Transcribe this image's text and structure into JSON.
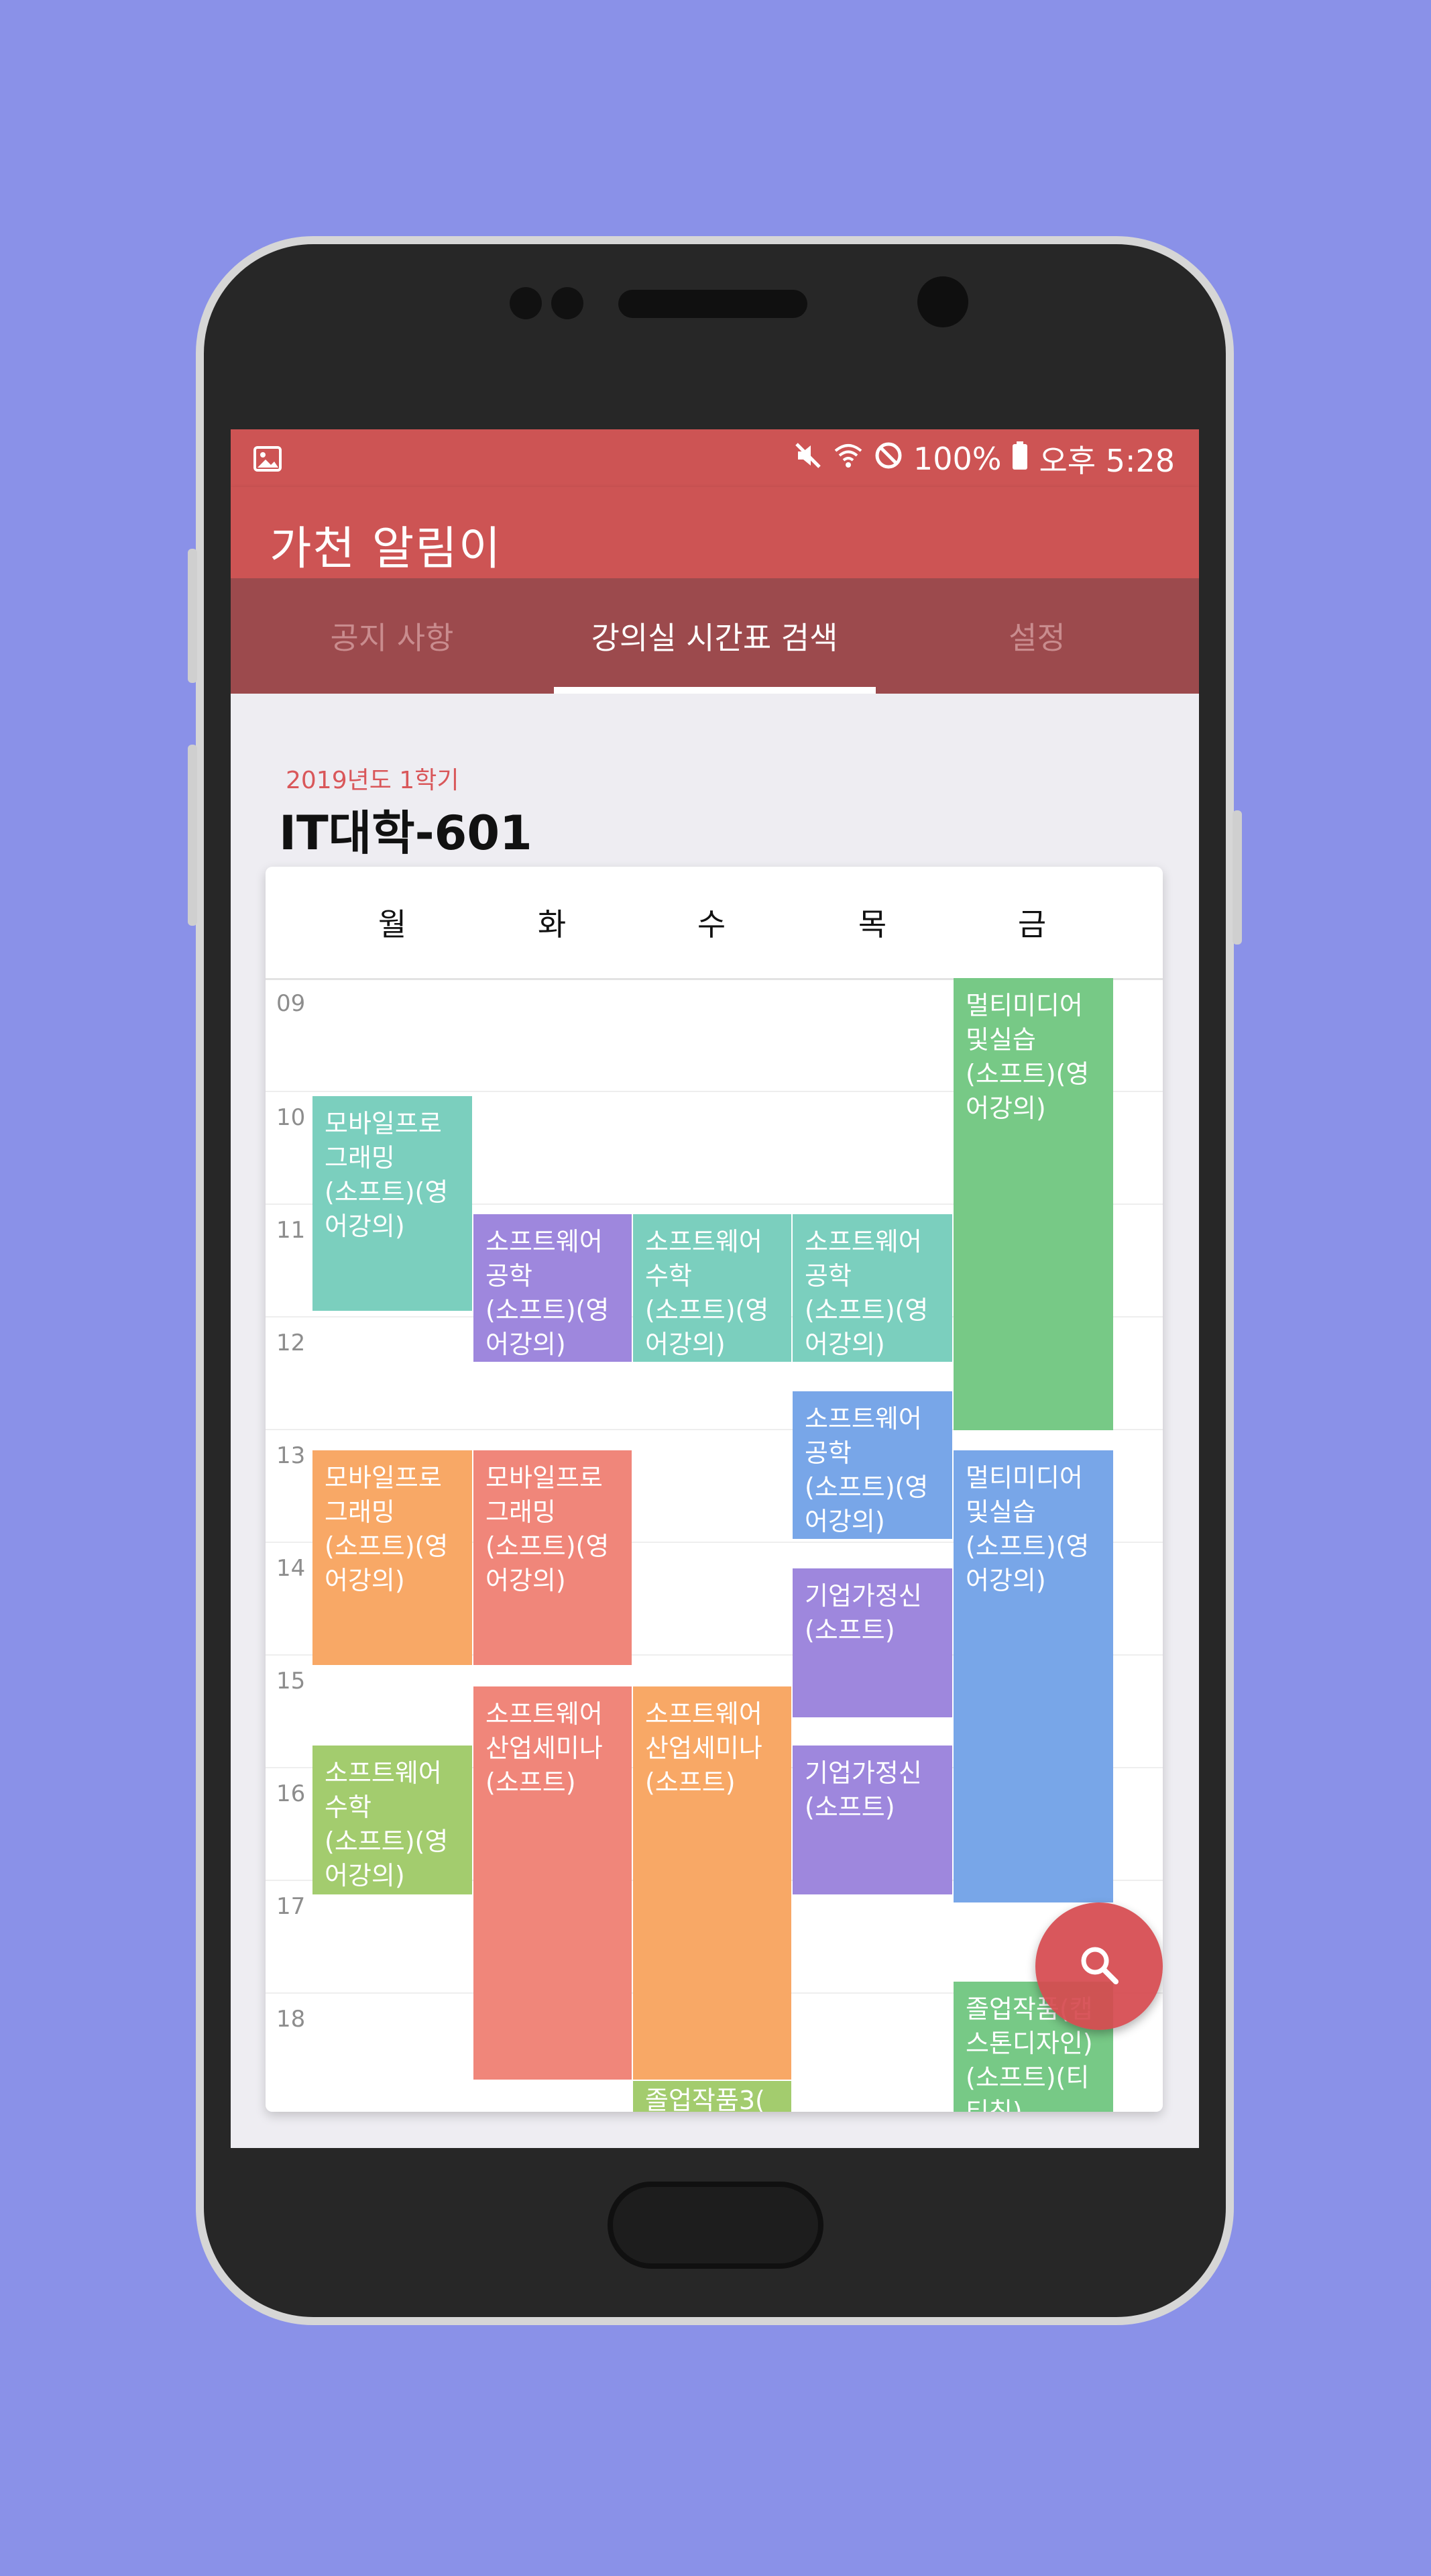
{
  "status_bar": {
    "battery": "100%",
    "time": "오후 5:28"
  },
  "app": {
    "title": "가천 알림이"
  },
  "tabs": [
    {
      "label": "공지 사항"
    },
    {
      "label": "강의실 시간표 검색"
    },
    {
      "label": "설정"
    }
  ],
  "timetable": {
    "semester": "2019년도 1학기",
    "room": "IT대학-601",
    "days": [
      "월",
      "화",
      "수",
      "목",
      "금"
    ],
    "hours": [
      "09",
      "10",
      "11",
      "12",
      "13",
      "14",
      "15",
      "16",
      "17",
      "18"
    ],
    "courses": [
      {
        "name": "모바일프로그래밍",
        "meta": "(소프트)(영어강의)",
        "color": "#7bcfbe"
      },
      {
        "name": "소프트웨어공학",
        "meta": "(소프트)(영어강의)",
        "color": "#9e87dd"
      },
      {
        "name": "소프트웨어수학",
        "meta": "(소프트)(영어강의)",
        "color": "#7bcfbe"
      },
      {
        "name": "소프트웨어공학",
        "meta": "(소프트)(영어강의)",
        "color": "#7bcfbe"
      },
      {
        "name": "멀티미디어및실습",
        "meta": "(소프트)(영어강의)",
        "color": "#77c986"
      },
      {
        "name": "소프트웨어공학",
        "meta": "(소프트)(영어강의)",
        "color": "#78a6e8"
      },
      {
        "name": "모바일프로그래밍",
        "meta": "(소프트)(영어강의)",
        "color": "#f8a866"
      },
      {
        "name": "모바일프로그래밍",
        "meta": "(소프트)(영어강의)",
        "color": "#f0867a"
      },
      {
        "name": "멀티미디어및실습",
        "meta": "(소프트)(영어강의)",
        "color": "#78a6e8"
      },
      {
        "name": "기업가정신",
        "meta": "(소프트)",
        "color": "#9e87dd"
      },
      {
        "name": "소프트웨어산업세미나",
        "meta": "(소프트)",
        "color": "#f0867a"
      },
      {
        "name": "소프트웨어산업세미나",
        "meta": "(소프트)",
        "color": "#f8a866"
      },
      {
        "name": "소프트웨어수학",
        "meta": "(소프트)(영어강의)",
        "color": "#a3cc6e"
      },
      {
        "name": "기업가정신",
        "meta": "(소프트)",
        "color": "#9e87dd"
      },
      {
        "name": "졸업작품(캡스톤디자인)",
        "meta": "(소프트)(티티칭)",
        "color": "#77c986"
      },
      {
        "name": "졸업작품3(",
        "meta": "",
        "color": "#a3cc6e"
      }
    ]
  },
  "icons": {
    "status_left": "image-icon",
    "status_right": [
      "mute-icon",
      "wifi-icon",
      "blocked-icon",
      "battery-icon"
    ],
    "fab": "search-icon"
  },
  "colors": {
    "primary": "#cd5454",
    "tab_bar": "#9c4a4d",
    "accent_text": "#d9575a",
    "background": "#8a91e8"
  }
}
